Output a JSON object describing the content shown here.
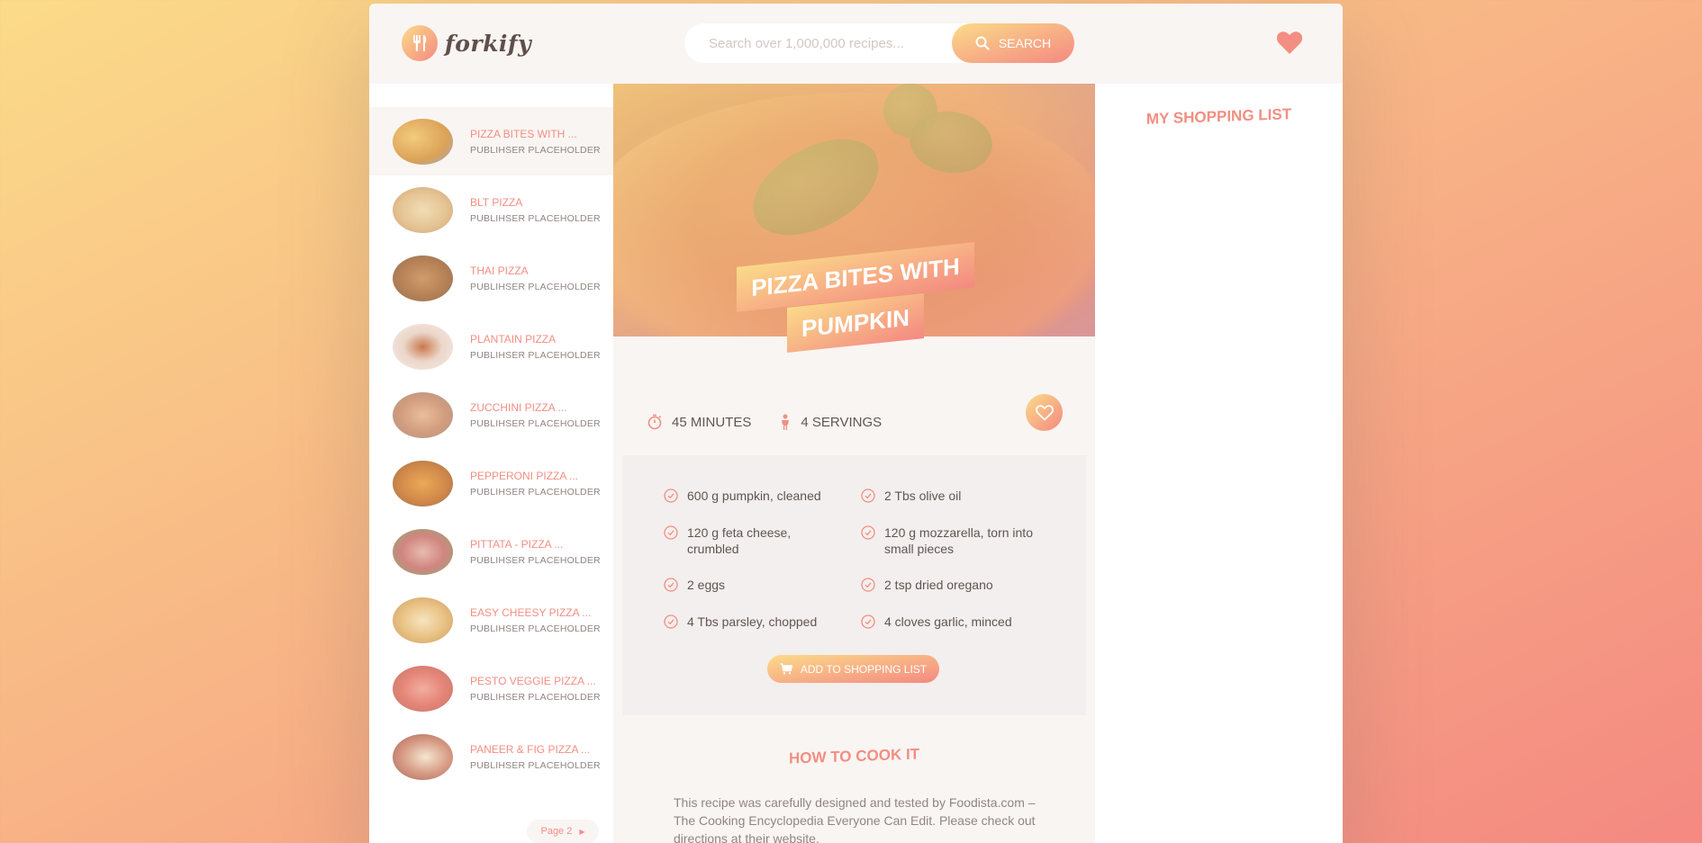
{
  "header": {
    "logo_text": "forkify",
    "search_placeholder": "Search over 1,000,000 recipes...",
    "search_button": "SEARCH"
  },
  "results": {
    "items": [
      {
        "title": "PIZZA BITES WITH ...",
        "publisher": "PUBLIHSER PLACEHOLDER",
        "active": true
      },
      {
        "title": "BLT PIZZA",
        "publisher": "PUBLIHSER PLACEHOLDER"
      },
      {
        "title": "THAI PIZZA",
        "publisher": "PUBLIHSER PLACEHOLDER"
      },
      {
        "title": "PLANTAIN PIZZA",
        "publisher": "PUBLIHSER PLACEHOLDER"
      },
      {
        "title": "ZUCCHINI PIZZA ...",
        "publisher": "PUBLIHSER PLACEHOLDER"
      },
      {
        "title": "PEPPERONI PIZZA ...",
        "publisher": "PUBLIHSER PLACEHOLDER"
      },
      {
        "title": "PITTATA - PIZZA ...",
        "publisher": "PUBLIHSER PLACEHOLDER"
      },
      {
        "title": "EASY CHEESY PIZZA ...",
        "publisher": "PUBLIHSER PLACEHOLDER"
      },
      {
        "title": "PESTO VEGGIE PIZZA ...",
        "publisher": "PUBLIHSER PLACEHOLDER"
      },
      {
        "title": "PANEER & FIG PIZZA ...",
        "publisher": "PUBLIHSER PLACEHOLDER"
      }
    ],
    "next_page": "Page 2"
  },
  "recipe": {
    "title_line1": "PIZZA BITES WITH",
    "title_line2": "PUMPKIN",
    "time": "45 MINUTES",
    "servings": "4 SERVINGS",
    "ingredients": [
      "600 g pumpkin, cleaned",
      "2 Tbs olive oil",
      "120 g feta cheese, crumbled",
      "120 g mozzarella, torn into small pieces",
      "2 eggs",
      "2 tsp dried oregano",
      "4 Tbs parsley, chopped",
      "4 cloves garlic, minced"
    ],
    "add_to_list": "ADD TO SHOPPING LIST",
    "directions_heading": "HOW TO COOK IT",
    "directions_text": "This recipe was carefully designed and tested by Foodista.com – The Cooking Encyclopedia Everyone Can Edit. Please check out directions at their website."
  },
  "shopping": {
    "heading": "MY SHOPPING LIST"
  },
  "colors": {
    "accent": "#f38e82",
    "gradient_start": "#fbdb89",
    "gradient_end": "#f48982",
    "panel": "#f9f5f3"
  }
}
